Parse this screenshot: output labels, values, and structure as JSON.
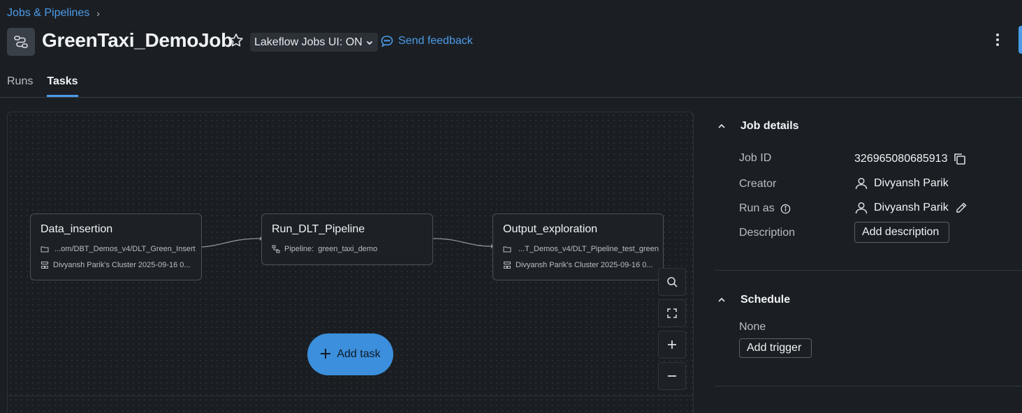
{
  "breadcrumb": {
    "label": "Jobs & Pipelines",
    "chevron": "›"
  },
  "header": {
    "title": "GreenTaxi_DemoJob",
    "lakeflow_toggle": "Lakeflow Jobs UI: ON",
    "feedback_label": "Send feedback"
  },
  "tabs": [
    {
      "label": "Runs",
      "active": false
    },
    {
      "label": "Tasks",
      "active": true
    }
  ],
  "tasks": [
    {
      "name": "Data_insertion",
      "path": "...om/DBT_Demos_v4/DLT_Green_Insert",
      "cluster": "Divyansh Parik's Cluster 2025-09-16 0..."
    },
    {
      "name": "Run_DLT_Pipeline",
      "pipeline_label": "Pipeline:",
      "pipeline": "green_taxi_demo"
    },
    {
      "name": "Output_exploration",
      "path": "...T_Demos_v4/DLT_Pipeline_test_green",
      "cluster": "Divyansh Parik's Cluster 2025-09-16 0..."
    }
  ],
  "canvas": {
    "add_task_label": "Add task",
    "accent": "#3b8fdc"
  },
  "job_details": {
    "heading": "Job details",
    "job_id_label": "Job ID",
    "job_id": "326965080685913",
    "creator_label": "Creator",
    "creator": "Divyansh Parik",
    "run_as_label": "Run as",
    "run_as": "Divyansh Parik",
    "description_label": "Description",
    "add_description": "Add description"
  },
  "schedule": {
    "heading": "Schedule",
    "value": "None",
    "add_trigger": "Add trigger"
  },
  "colors": {
    "link": "#4c9be8",
    "background": "#1b1f24"
  }
}
